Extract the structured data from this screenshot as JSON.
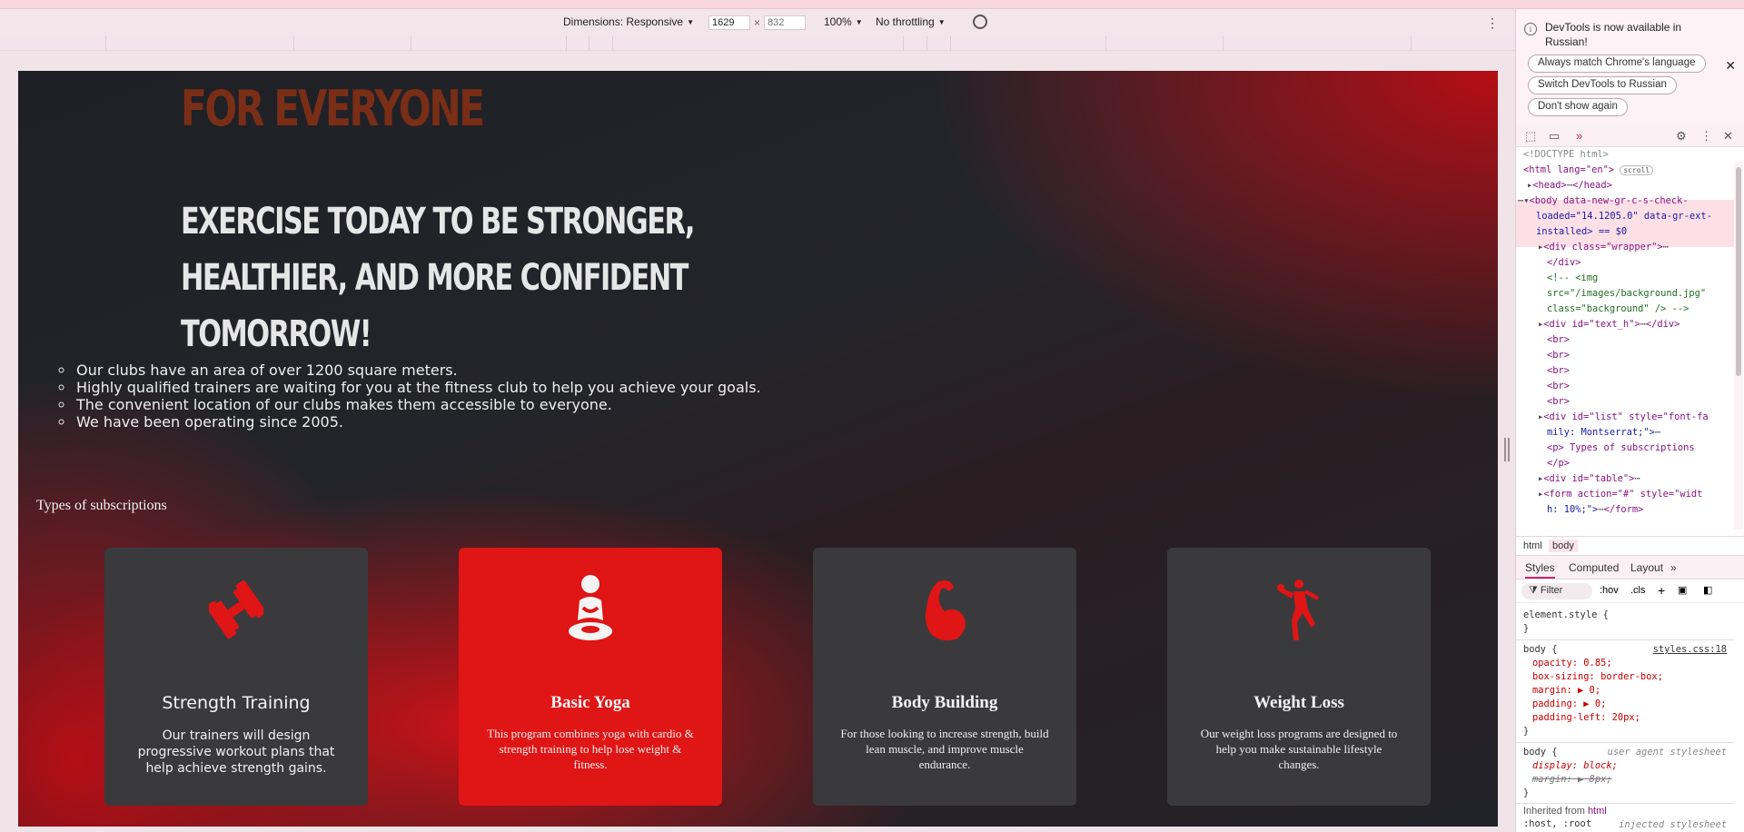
{
  "device_toolbar": {
    "dimensions_label": "Dimensions: Responsive",
    "width": "1629",
    "height": "832",
    "zoom": "100%",
    "throttling": "No throttling"
  },
  "page": {
    "hero_top": "FOR EVERYONE",
    "hero_lines": [
      "EXERCISE TODAY TO BE STRONGER,",
      "HEALTHIER, AND MORE CONFIDENT",
      "TOMORROW!"
    ],
    "features": [
      "Our clubs have an area of over 1200 square meters.",
      "Highly qualified trainers are waiting for you at the fitness club to help you achieve your goals.",
      "The convenient location of our clubs makes them accessible to everyone.",
      "We have been operating since 2005."
    ],
    "subscriptions_title": "Types of subscriptions",
    "cards": [
      {
        "icon": "dumbbell-icon",
        "title": "Strength Training",
        "desc": "Our trainers will design progressive workout plans that help achieve strength gains."
      },
      {
        "icon": "yoga-icon",
        "title": "Basic Yoga",
        "desc": "This program combines yoga with cardio & strength training to help lose weight & fitness."
      },
      {
        "icon": "flexed-arm-icon",
        "title": "Body Building",
        "desc": "For those looking to increase strength, build lean muscle, and improve muscle endurance."
      },
      {
        "icon": "running-figure-icon",
        "title": "Weight Loss",
        "desc": "Our weight loss programs are designed to help you make sustainable lifestyle changes."
      }
    ]
  },
  "devtools": {
    "notice_line1": "DevTools is now available in",
    "notice_line2": "Russian!",
    "btn_match": "Always match Chrome's language",
    "btn_switch": "Switch DevTools to Russian",
    "btn_dont_show": "Don't show again",
    "dom": {
      "doctype": "<!DOCTYPE html>",
      "html_open": "<html lang=\"en\">",
      "scroll_badge": "scroll",
      "head": "<head>",
      "head_close": "</head>",
      "body1": "<body data-new-gr-c-s-check-",
      "body2": "loaded=\"14.1205.0\" data-gr-ext-",
      "body3": "installed> == $0",
      "wrapper": "<div class=\"wrapper\">",
      "div_close": "</div>",
      "cmt1": "<!-- <img",
      "cmt2": "src=\"/images/background.jpg\"",
      "cmt3": "class=\"background\" /> -->",
      "text_h": "<div id=\"text_h\">",
      "br": "<br>",
      "list1": "<div id=\"list\" style=\"font-fa",
      "list2": "mily: Montserrat;\">",
      "p_open": "<p> Types of subscriptions",
      "p_close": "</p>",
      "table": "<div id=\"table\">",
      "form1": "<form action=\"#\" style=\"widt",
      "form2": "h: 10%;\">",
      "form_close": "</form>"
    },
    "crumb_html": "html",
    "crumb_body": "body",
    "tab_styles": "Styles",
    "tab_computed": "Computed",
    "tab_layout": "Layout",
    "filter": "Filter",
    "hov": ":hov",
    "cls": ".cls",
    "styles": {
      "element_style": "element.style {",
      "close": "}",
      "body_sel": "body {",
      "src": "styles.css:18",
      "opacity": "opacity: 0.85;",
      "box_sizing": "box-sizing: border-box;",
      "margin": "margin: ▶ 0;",
      "padding": "padding: ▶ 0;",
      "padding_left": "padding-left: 20px;",
      "ua_label": "user agent stylesheet",
      "display": "display: block;",
      "margin_8": "margin: ▶ 8px;",
      "inherited": "Inherited from",
      "inherited_el": "html",
      "host_root": ":host, :root",
      "injected": "injected stylesheet"
    }
  },
  "colors": {
    "accent_red": "#e01515",
    "card_dark": "#3a3a3d",
    "hero_brown": "#7a2e16"
  }
}
